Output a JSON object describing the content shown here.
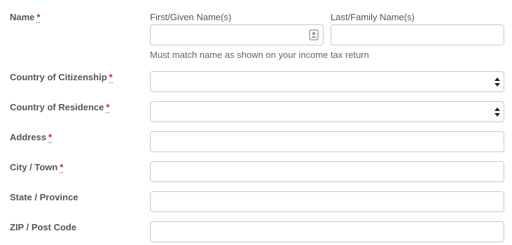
{
  "fields": {
    "name": {
      "label": "Name",
      "required_mark": "*",
      "first_label": "First/Given Name(s)",
      "last_label": "Last/Family Name(s)",
      "first_value": "",
      "last_value": "",
      "help": "Must match name as shown on your income tax return"
    },
    "citizenship": {
      "label": "Country of Citizenship",
      "required_mark": "*",
      "value": ""
    },
    "residence": {
      "label": "Country of Residence",
      "required_mark": "*",
      "value": ""
    },
    "address": {
      "label": "Address",
      "required_mark": "*",
      "value": ""
    },
    "city": {
      "label": "City / Town",
      "required_mark": "*",
      "value": ""
    },
    "state": {
      "label": "State / Province",
      "value": ""
    },
    "zip": {
      "label": "ZIP / Post Code",
      "value": ""
    }
  },
  "colors": {
    "label_text": "#555555",
    "required_mark": "#c62828",
    "input_border": "#c8c8c8"
  },
  "icons": {
    "first_name_autofill": "contact-card-icon",
    "select_arrows": "up-down-arrows-icon"
  }
}
